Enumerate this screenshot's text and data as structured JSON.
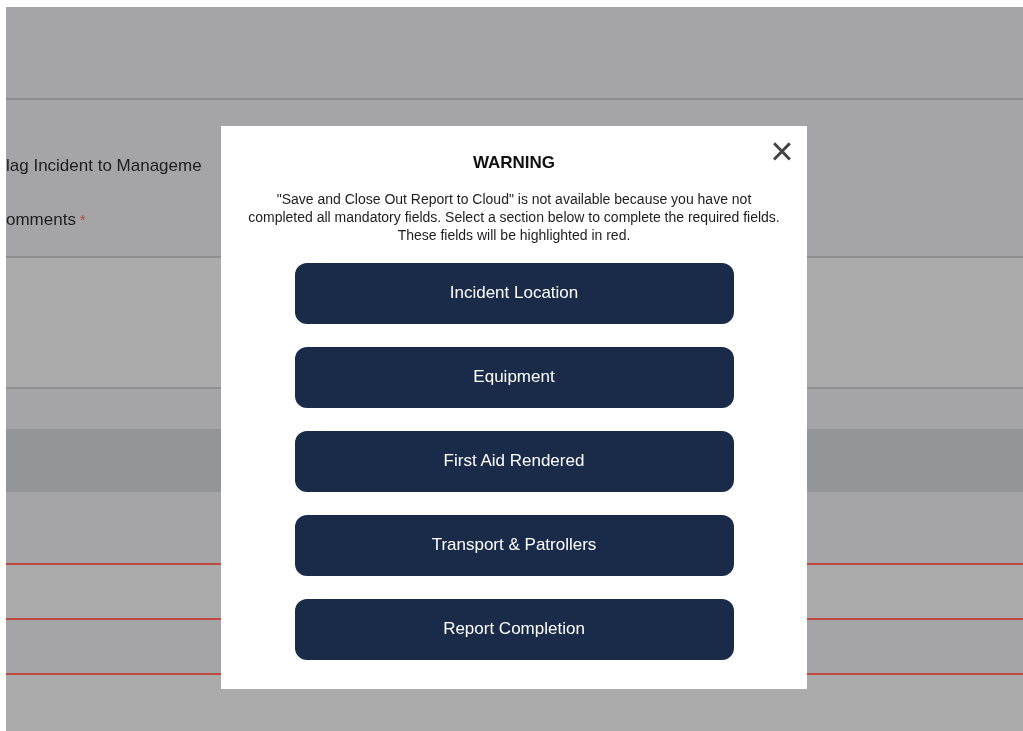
{
  "form": {
    "fields": [
      {
        "label": "lag Incident to Manageme"
      },
      {
        "label": "omments",
        "required_mark": "*"
      }
    ],
    "highlighted_rows": [
      {
        "invalid": true
      },
      {
        "invalid": true
      },
      {
        "invalid": true
      }
    ]
  },
  "dialog": {
    "title": "WARNING",
    "close": "×",
    "message": "\"Save and Close Out Report to Cloud\" is not available because you have not completed all mandatory fields. Select a section below to complete the required fields. These fields will be highlighted in red.",
    "sections": [
      "Incident Location",
      "Equipment",
      "First Aid Rendered",
      "Transport & Patrollers",
      "Report Completion"
    ]
  }
}
